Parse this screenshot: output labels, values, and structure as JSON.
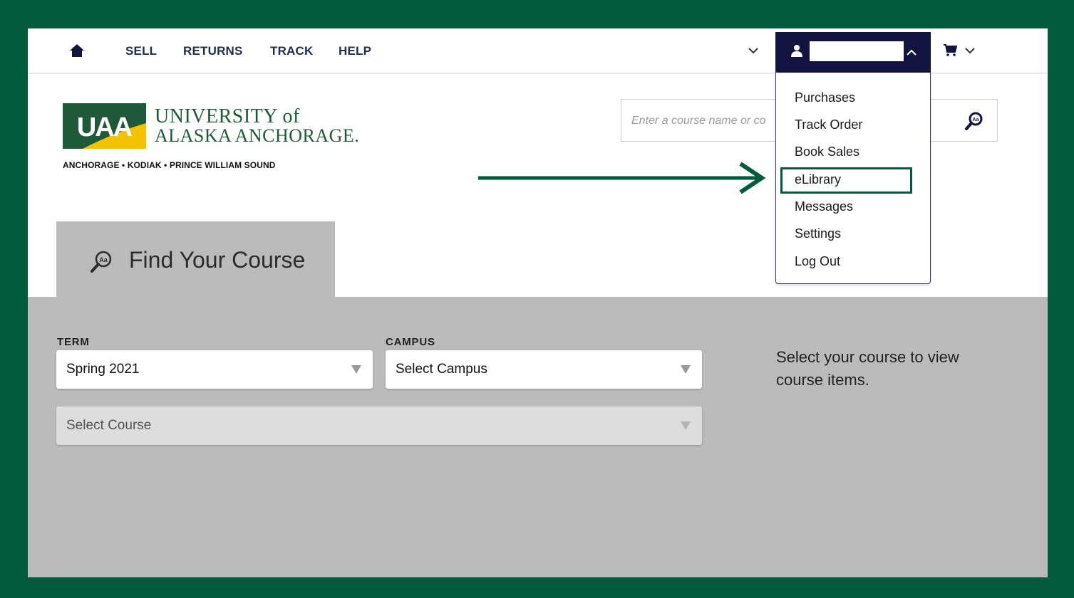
{
  "nav": {
    "links": [
      "SELL",
      "RETURNS",
      "TRACK",
      "HELP"
    ]
  },
  "logo": {
    "line1": "UNIVERSITY of",
    "line2": "ALASKA ANCHORAGE.",
    "subtitle": "ANCHORAGE • KODIAK • PRINCE WILLIAM SOUND"
  },
  "search": {
    "placeholder": "Enter a course name or co"
  },
  "account_menu": {
    "items": [
      "Purchases",
      "Track Order",
      "Book Sales",
      "eLibrary",
      "Messages",
      "Settings",
      "Log Out"
    ],
    "highlighted": "eLibrary"
  },
  "find_course": {
    "tab_label": "Find Your Course",
    "term_label": "TERM",
    "term_value": "Spring 2021",
    "campus_label": "CAMPUS",
    "campus_value": "Select Campus",
    "course_value": "Select Course",
    "helper": "Select your course to view course items."
  },
  "colors": {
    "border_green": "#005a3c",
    "nav_navy": "#131340",
    "panel_gray": "#bbbbbb"
  }
}
